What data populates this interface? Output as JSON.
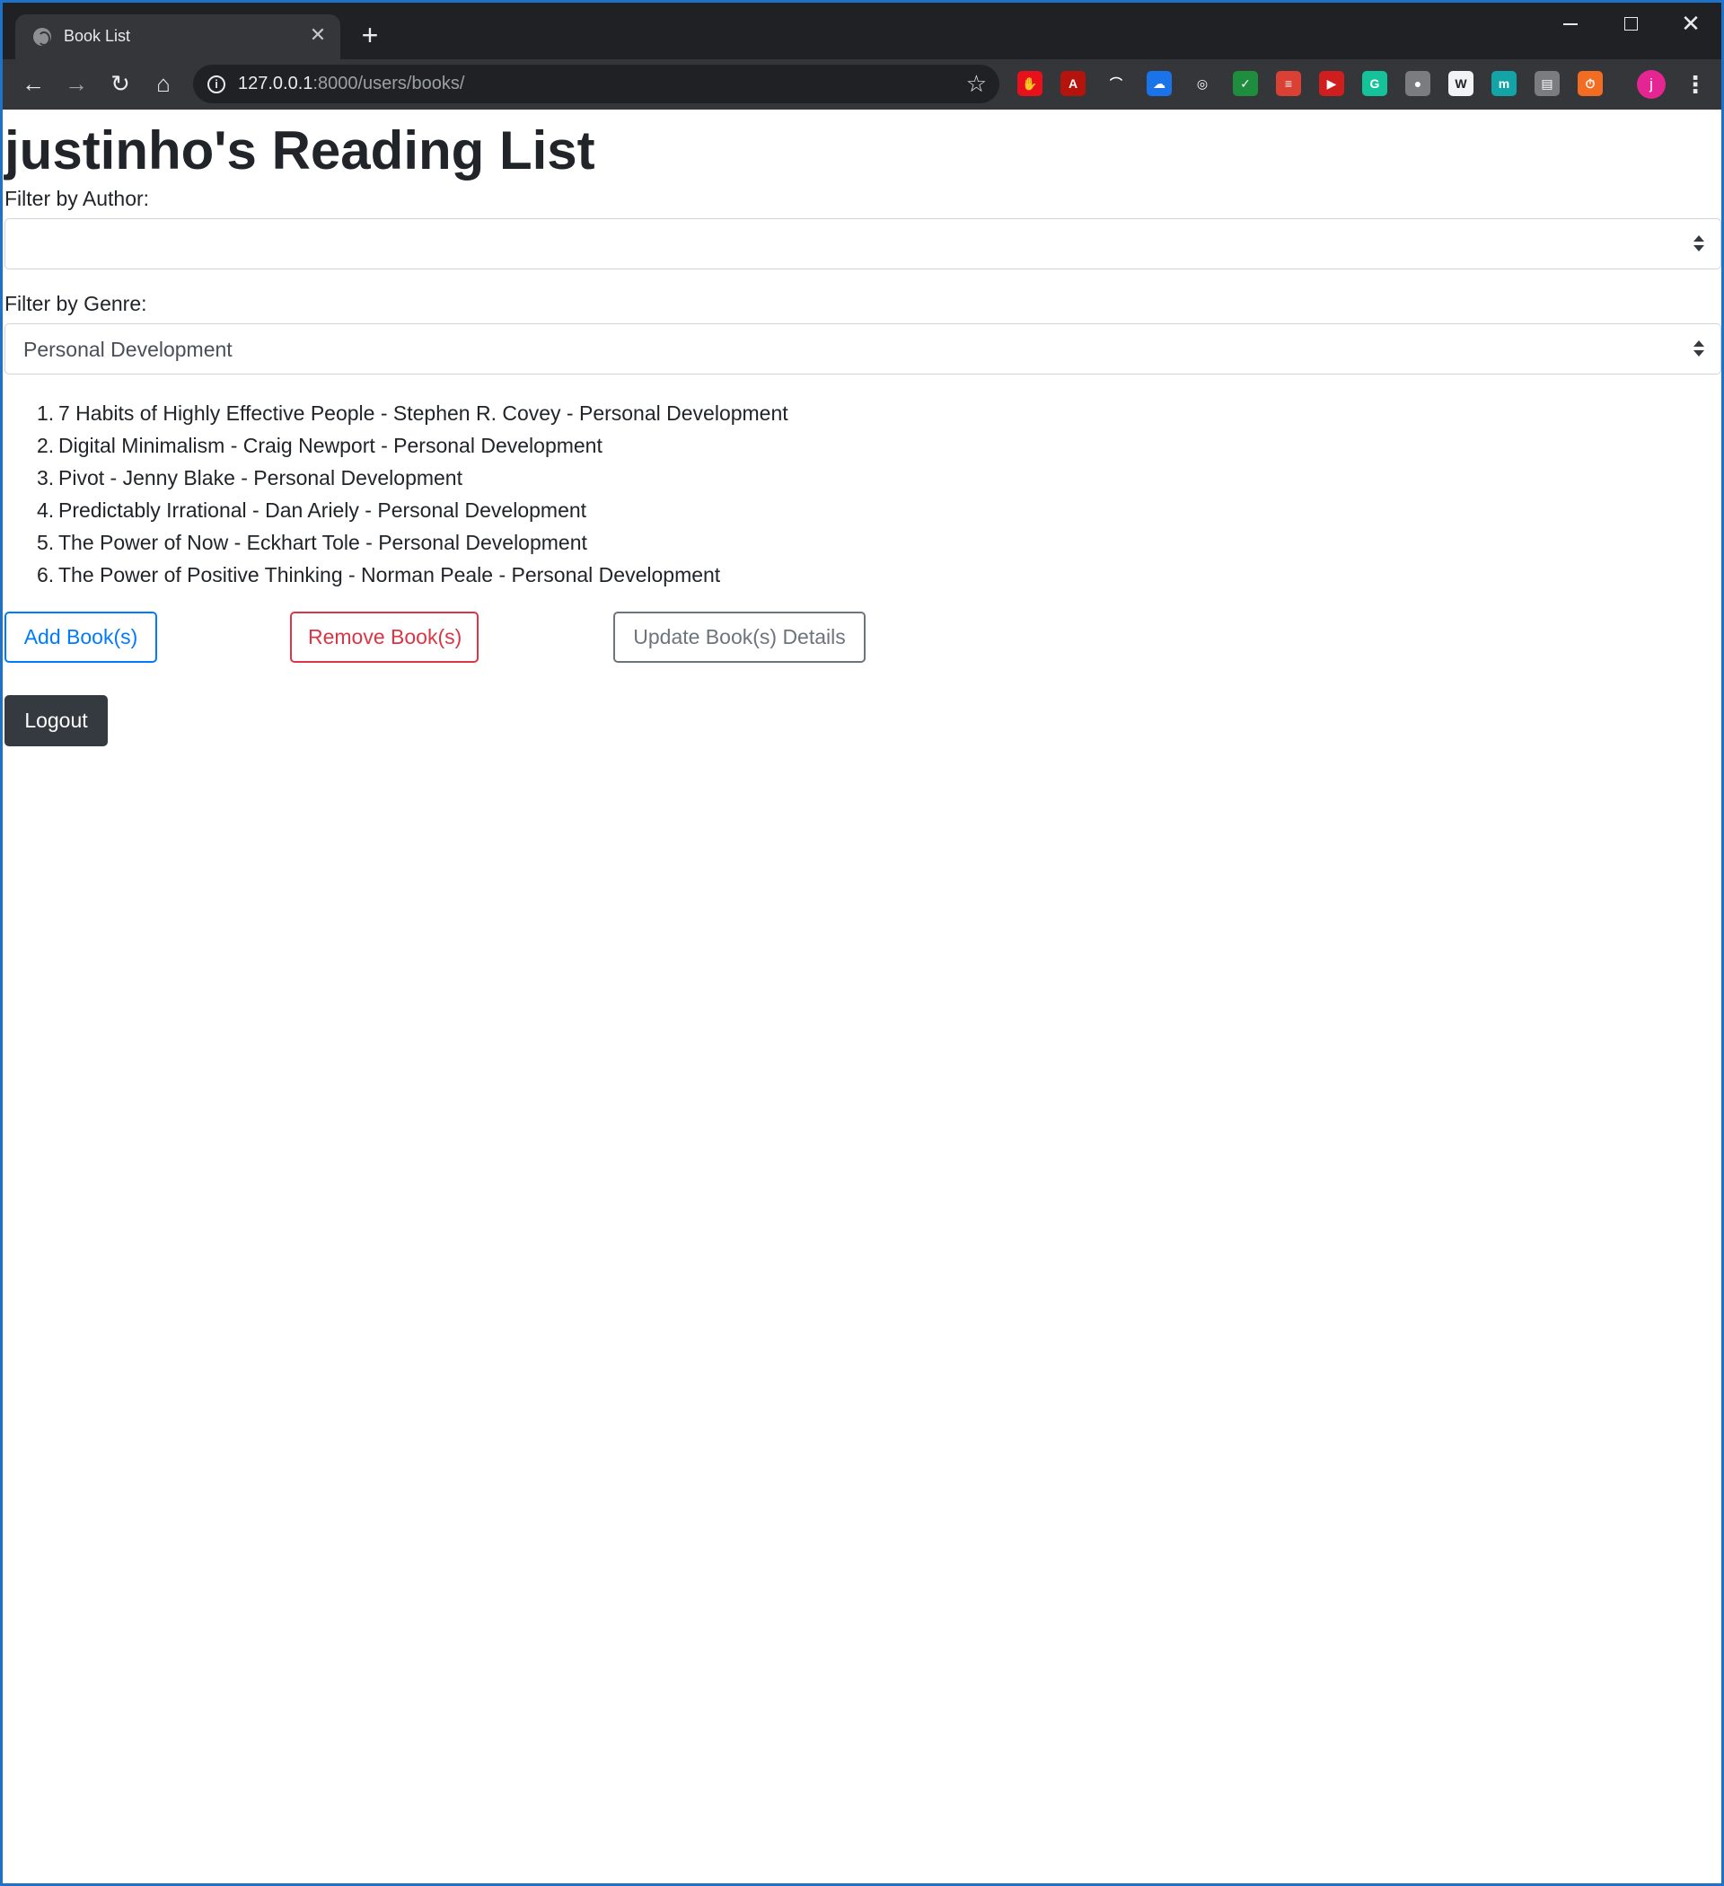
{
  "browser": {
    "tab_title": "Book List",
    "tab_close_glyph": "✕",
    "new_tab_glyph": "+",
    "window_controls": {
      "close_glyph": "✕"
    },
    "nav": {
      "back_glyph": "←",
      "forward_glyph": "→",
      "reload_glyph": "↻",
      "home_glyph": "⌂"
    },
    "url": {
      "host": "127.0.0.1",
      "rest": ":8000/users/books/"
    },
    "star_glyph": "☆",
    "extensions": [
      {
        "name": "stop-hand-extension-icon",
        "color": "#e8101b",
        "glyph": "✋"
      },
      {
        "name": "acrobat-extension-icon",
        "color": "#b4140c",
        "glyph": "A"
      },
      {
        "name": "rainbow-extension-icon",
        "color": "#35363a",
        "glyph": "⌒"
      },
      {
        "name": "cloud-extension-icon",
        "color": "#1a73e8",
        "glyph": "☁"
      },
      {
        "name": "headphones-extension-icon",
        "color": "#35363a",
        "glyph": "◎"
      },
      {
        "name": "checkmark-extension-icon",
        "color": "#1e8e3e",
        "glyph": "✓"
      },
      {
        "name": "todoist-extension-icon",
        "color": "#db4035",
        "glyph": "≡"
      },
      {
        "name": "red-play-extension-icon",
        "color": "#d01d1d",
        "glyph": "▶"
      },
      {
        "name": "grammarly-extension-icon",
        "color": "#15c39a",
        "glyph": "G"
      },
      {
        "name": "camera-extension-icon",
        "color": "#7a7c80",
        "glyph": "●"
      },
      {
        "name": "wikipedia-extension-icon",
        "color": "#f1f3f4",
        "glyph": "W"
      },
      {
        "name": "teal-m-extension-icon",
        "color": "#12a4a6",
        "glyph": "m"
      },
      {
        "name": "gray-chart-extension-icon",
        "color": "#7a7c80",
        "glyph": "▤"
      },
      {
        "name": "orange-timer-extension-icon",
        "color": "#f26c21",
        "glyph": "⏱"
      }
    ],
    "profile_initial": "j",
    "menu_glyph": "⋮"
  },
  "page": {
    "title": "justinho's Reading List",
    "author_filter": {
      "label": "Filter by Author:",
      "selected": ""
    },
    "genre_filter": {
      "label": "Filter by Genre:",
      "selected": "Personal Development"
    },
    "books": [
      {
        "num": "1.",
        "text": "7 Habits of Highly Effective People - Stephen R. Covey - Personal Development"
      },
      {
        "num": "2.",
        "text": "Digital Minimalism - Craig Newport - Personal Development"
      },
      {
        "num": "3.",
        "text": "Pivot - Jenny Blake - Personal Development"
      },
      {
        "num": "4.",
        "text": "Predictably Irrational - Dan Ariely - Personal Development"
      },
      {
        "num": "5.",
        "text": "The Power of Now - Eckhart Tole - Personal Development"
      },
      {
        "num": "6.",
        "text": "The Power of Positive Thinking - Norman Peale - Personal Development"
      }
    ],
    "buttons": {
      "add": "Add Book(s)",
      "remove": "Remove Book(s)",
      "update": "Update Book(s) Details",
      "logout": "Logout"
    }
  },
  "colors": {
    "primary": "#007bff",
    "danger": "#dc3545",
    "secondary": "#6c757d",
    "dark": "#343a40",
    "window_border": "#1e73c8"
  }
}
